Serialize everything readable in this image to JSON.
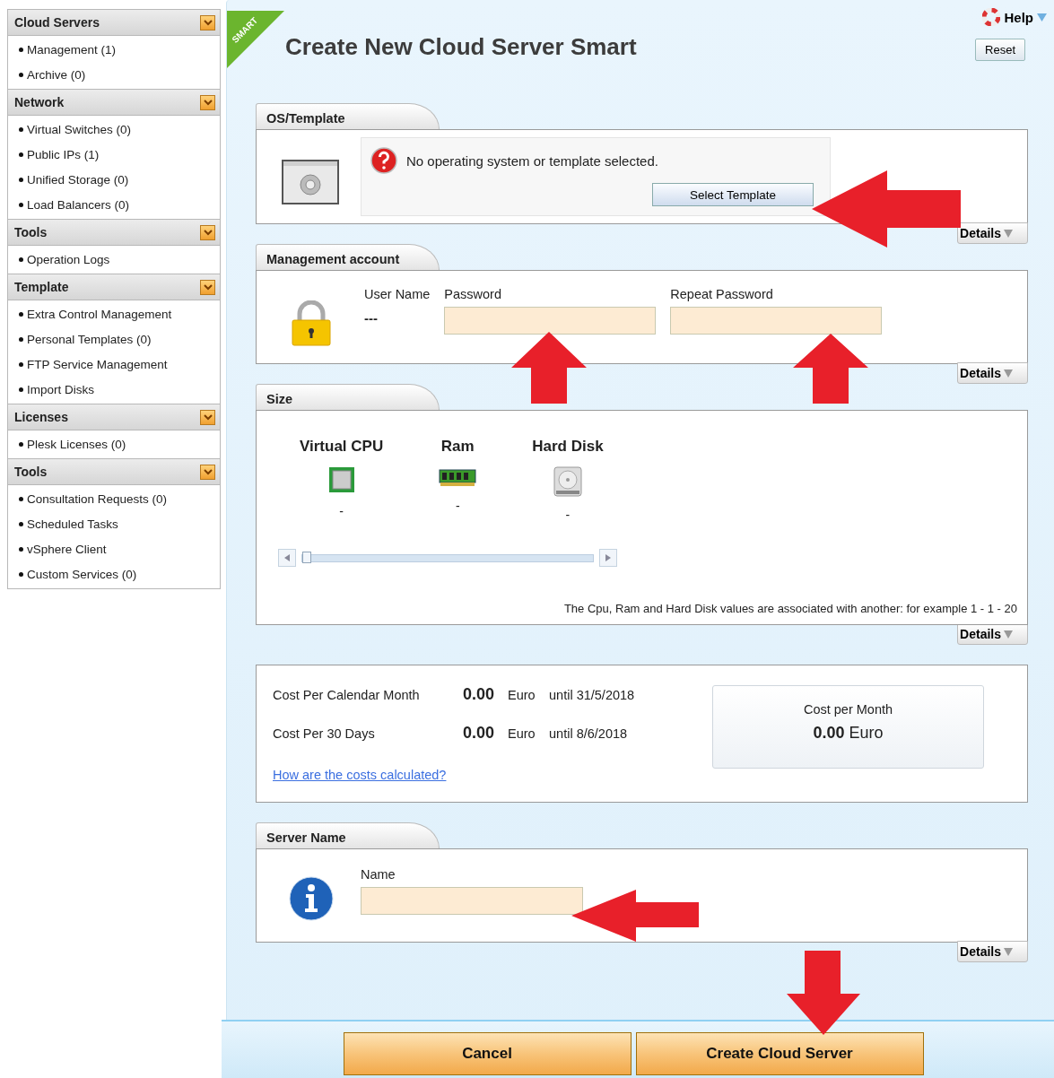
{
  "sidebar": [
    {
      "title": "Cloud Servers",
      "items": [
        "Management (1)",
        "Archive (0)"
      ]
    },
    {
      "title": "Network",
      "items": [
        "Virtual Switches (0)",
        "Public IPs (1)",
        "Unified Storage (0)",
        "Load Balancers (0)"
      ]
    },
    {
      "title": "Tools",
      "items": [
        "Operation Logs"
      ]
    },
    {
      "title": "Template",
      "items": [
        "Extra Control Management",
        "Personal Templates (0)",
        "FTP Service Management",
        "Import Disks"
      ]
    },
    {
      "title": "Licenses",
      "items": [
        "Plesk Licenses (0)"
      ]
    },
    {
      "title": "Tools",
      "items": [
        "Consultation Requests (0)",
        "Scheduled Tasks",
        "vSphere Client",
        "Custom Services (0)"
      ]
    }
  ],
  "page": {
    "badge": "SMART",
    "title": "Create New Cloud Server Smart",
    "help": "Help",
    "reset": "Reset"
  },
  "os_template": {
    "title": "OS/Template",
    "message": "No operating system or template selected.",
    "button": "Select Template",
    "details": "Details"
  },
  "management_account": {
    "title": "Management account",
    "user_name_label": "User Name",
    "user_name": "---",
    "password_label": "Password",
    "repeat_password_label": "Repeat Password",
    "details": "Details"
  },
  "size": {
    "title": "Size",
    "resources": [
      {
        "kind": "cpu",
        "label": "Virtual CPU",
        "value": "-"
      },
      {
        "kind": "ram",
        "label": "Ram",
        "value": "-"
      },
      {
        "kind": "disk",
        "label": "Hard Disk",
        "value": "-"
      }
    ],
    "slider": {
      "level": 0
    },
    "note": "The Cpu, Ram and Hard Disk values are associated with another: for example 1 - 1 - 20",
    "details": "Details"
  },
  "costs": {
    "rows": [
      {
        "label": "Cost Per Calendar Month",
        "amount": "0.00",
        "currency": "Euro",
        "until": "until 31/5/2018"
      },
      {
        "label": "Cost Per 30 Days",
        "amount": "0.00",
        "currency": "Euro",
        "until": "until 8/6/2018"
      }
    ],
    "link": "How are the costs calculated?",
    "summary": {
      "label": "Cost per Month",
      "value": "**0.00** Euro"
    }
  },
  "server_name": {
    "title": "Server Name",
    "name_label": "Name",
    "details": "Details"
  },
  "buttons": [
    "Cancel",
    "Create Cloud Server"
  ]
}
